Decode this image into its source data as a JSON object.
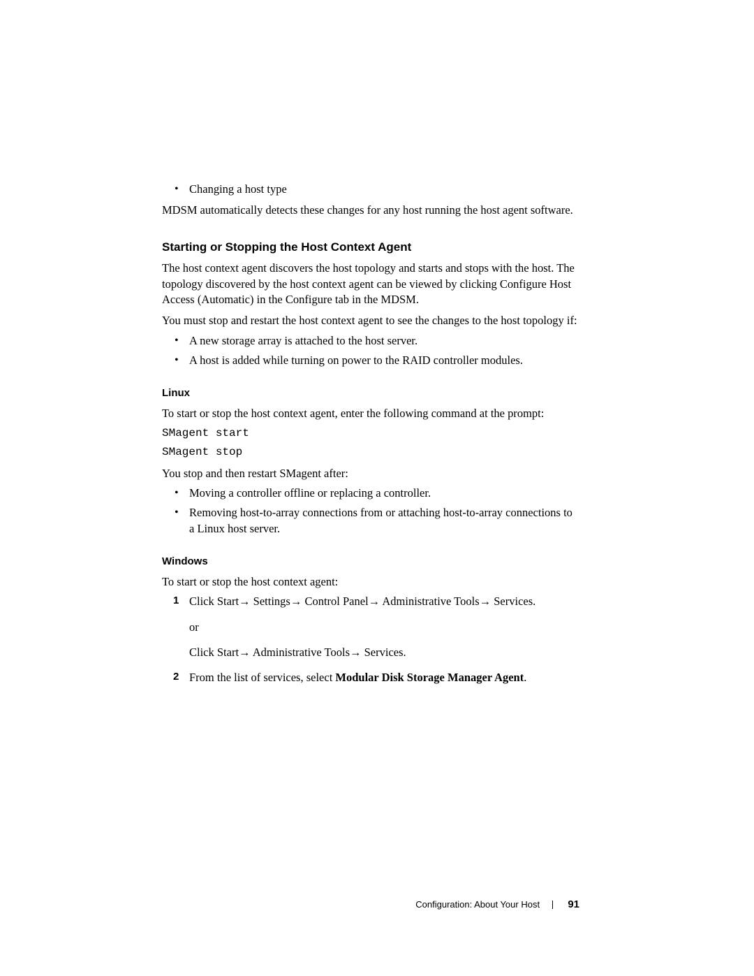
{
  "intro": {
    "bullets": [
      "Changing a host type"
    ],
    "para": "MDSM automatically detects these changes for any host running the host agent software."
  },
  "section": {
    "heading": "Starting or Stopping the Host Context Agent",
    "para1": "The host context agent discovers the host topology and starts and stops with the host. The topology discovered by the host context agent can be viewed by clicking Configure Host Access (Automatic) in the Configure tab in the MDSM.",
    "para2": "You must stop and restart the host context agent to see the changes to the host topology if:",
    "bullets": [
      "A new storage array is attached to the host server.",
      "A host is added while turning on power to the RAID controller modules."
    ]
  },
  "linux": {
    "heading": "Linux",
    "para1": "To start or stop the host context agent, enter the following command at the prompt:",
    "code1": "SMagent start",
    "code2": "SMagent stop",
    "para2": "You stop and then restart SMagent after:",
    "bullets": [
      "Moving a controller offline or replacing a controller.",
      "Removing host-to-array connections from or attaching host-to-array connections to a Linux host server."
    ]
  },
  "windows": {
    "heading": "Windows",
    "para1": "To start or stop the host context agent:",
    "step1_a": "Click Start→ Settings→ Control Panel→ Administrative Tools→ Services.",
    "step1_or": "or",
    "step1_b": "Click Start→ Administrative Tools→ Services.",
    "step2_prefix": "From the list of services, select ",
    "step2_bold": "Modular Disk Storage Manager Agent",
    "step2_suffix": "."
  },
  "footer": {
    "title": "Configuration: About Your Host",
    "page": "91"
  }
}
